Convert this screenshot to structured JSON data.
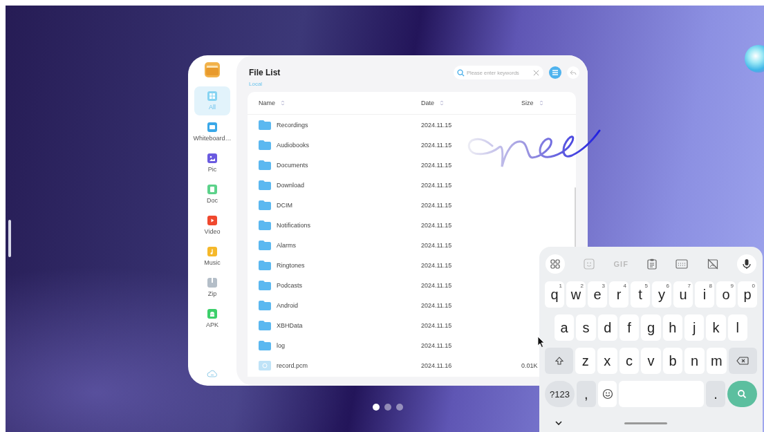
{
  "sidebar": {
    "items": [
      {
        "label": "All",
        "kind": "grid",
        "color": "#86d4f2",
        "selected": true
      },
      {
        "label": "Whiteboard…",
        "kind": "board",
        "color": "#3aa8e8",
        "selected": false
      },
      {
        "label": "Pic",
        "kind": "image",
        "color": "#6a5ae0",
        "selected": false
      },
      {
        "label": "Doc",
        "kind": "doc",
        "color": "#5cd28a",
        "selected": false
      },
      {
        "label": "Video",
        "kind": "play",
        "color": "#f0482e",
        "selected": false
      },
      {
        "label": "Music",
        "kind": "note",
        "color": "#f5b82a",
        "selected": false
      },
      {
        "label": "Zip",
        "kind": "zip",
        "color": "#b4bec8",
        "selected": false
      },
      {
        "label": "APK",
        "kind": "android",
        "color": "#3ccf6a",
        "selected": false
      }
    ]
  },
  "header": {
    "title": "File List",
    "breadcrumb": "Local",
    "search": {
      "placeholder": "Please enter keywords"
    },
    "list_view_selected": true
  },
  "table": {
    "columns": [
      {
        "label": "Name"
      },
      {
        "label": "Date"
      },
      {
        "label": "Size"
      }
    ],
    "rows": [
      {
        "kind": "folder",
        "name": "Recordings",
        "date": "2024.11.15"
      },
      {
        "kind": "folder",
        "name": "Audiobooks",
        "date": "2024.11.15"
      },
      {
        "kind": "folder",
        "name": "Documents",
        "date": "2024.11.15"
      },
      {
        "kind": "folder",
        "name": "Download",
        "date": "2024.11.15"
      },
      {
        "kind": "folder",
        "name": "DCIM",
        "date": "2024.11.15"
      },
      {
        "kind": "folder",
        "name": "Notifications",
        "date": "2024.11.15"
      },
      {
        "kind": "folder",
        "name": "Alarms",
        "date": "2024.11.15"
      },
      {
        "kind": "folder",
        "name": "Ringtones",
        "date": "2024.11.15"
      },
      {
        "kind": "folder",
        "name": "Podcasts",
        "date": "2024.11.15"
      },
      {
        "kind": "folder",
        "name": "Android",
        "date": "2024.11.15"
      },
      {
        "kind": "folder",
        "name": "XBHData",
        "date": "2024.11.15"
      },
      {
        "kind": "folder",
        "name": "log",
        "date": "2024.11.15"
      },
      {
        "kind": "file",
        "name": "record.pcm",
        "date": "2024.11.16",
        "size": "0.01K"
      }
    ]
  },
  "pager": [
    {
      "selected": true
    },
    {
      "selected": false
    },
    {
      "selected": false
    }
  ],
  "keyboard": {
    "gif_label": "GIF",
    "rows": [
      {
        "keys": [
          {
            "kind": "letter",
            "label": "q",
            "hint": "1"
          },
          {
            "kind": "letter",
            "label": "w",
            "hint": "2"
          },
          {
            "kind": "letter",
            "label": "e",
            "hint": "3"
          },
          {
            "kind": "letter",
            "label": "r",
            "hint": "4"
          },
          {
            "kind": "letter",
            "label": "t",
            "hint": "5"
          },
          {
            "kind": "letter",
            "label": "y",
            "hint": "6"
          },
          {
            "kind": "letter",
            "label": "u",
            "hint": "7"
          },
          {
            "kind": "letter",
            "label": "i",
            "hint": "8"
          },
          {
            "kind": "letter",
            "label": "o",
            "hint": "9"
          },
          {
            "kind": "letter",
            "label": "p",
            "hint": "0"
          }
        ]
      },
      {
        "keys": [
          {
            "kind": "letter",
            "label": "a"
          },
          {
            "kind": "letter",
            "label": "s"
          },
          {
            "kind": "letter",
            "label": "d"
          },
          {
            "kind": "letter",
            "label": "f"
          },
          {
            "kind": "letter",
            "label": "g"
          },
          {
            "kind": "letter",
            "label": "h"
          },
          {
            "kind": "letter",
            "label": "j"
          },
          {
            "kind": "letter",
            "label": "k"
          },
          {
            "kind": "letter",
            "label": "l"
          }
        ]
      },
      {
        "keys": [
          {
            "kind": "shift"
          },
          {
            "kind": "letter",
            "label": "z"
          },
          {
            "kind": "letter",
            "label": "x"
          },
          {
            "kind": "letter",
            "label": "c"
          },
          {
            "kind": "letter",
            "label": "v"
          },
          {
            "kind": "letter",
            "label": "b"
          },
          {
            "kind": "letter",
            "label": "n"
          },
          {
            "kind": "letter",
            "label": "m"
          },
          {
            "kind": "backspace"
          }
        ]
      },
      {
        "keys": [
          {
            "kind": "symbols",
            "label": "?123"
          },
          {
            "kind": "punct",
            "label": ","
          },
          {
            "kind": "emoji"
          },
          {
            "kind": "space"
          },
          {
            "kind": "punct",
            "label": "."
          },
          {
            "kind": "search"
          }
        ]
      }
    ]
  }
}
